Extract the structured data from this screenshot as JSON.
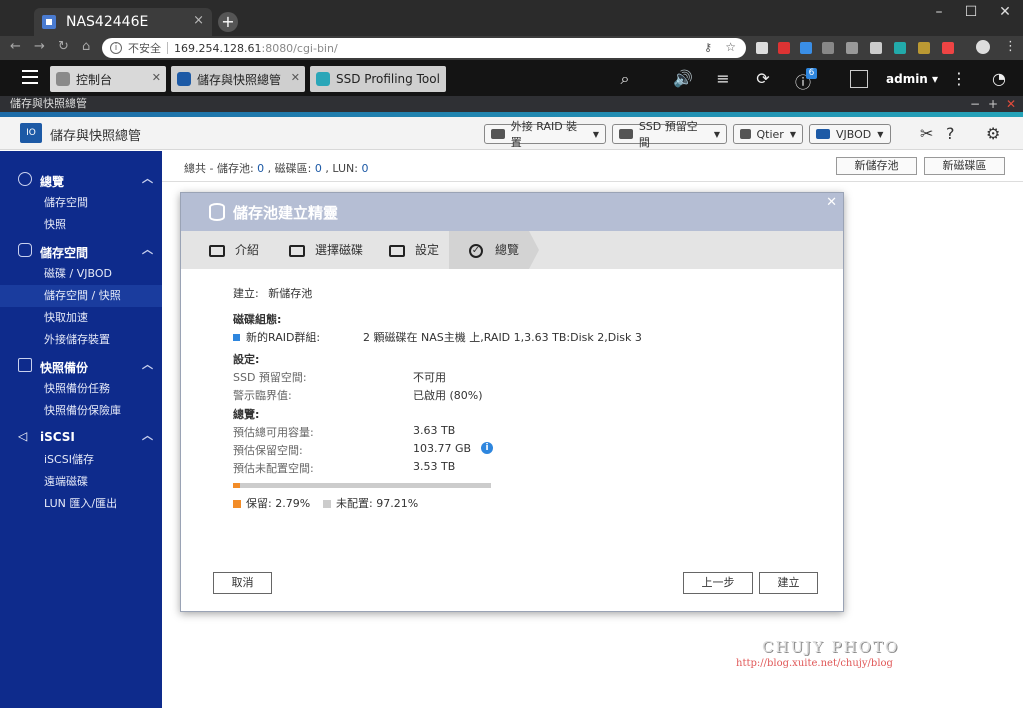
{
  "browser": {
    "tab_title": "NAS42446E",
    "tab_close": "×",
    "new_tab": "+",
    "security_label": "不安全",
    "url_host": "169.254.128.61",
    "url_rest": ":8080/cgi-bin/"
  },
  "qts": {
    "open_tabs": [
      {
        "label": "控制台"
      },
      {
        "label": "儲存與快照總管"
      },
      {
        "label": "SSD Profiling Tool"
      }
    ],
    "notification_count": "6",
    "user": "admin"
  },
  "app": {
    "window_title": "儲存與快照總管",
    "header_title": "儲存與快照總管",
    "toolbar": {
      "external_raid": "外接 RAID 裝置",
      "ssd_overprov": "SSD 預留空間",
      "qtier": "Qtier",
      "vjbod": "VJBOD"
    }
  },
  "sidebar": {
    "sections": [
      {
        "label": "總覽",
        "items": [
          "儲存空間",
          "快照"
        ]
      },
      {
        "label": "儲存空間",
        "items": [
          "磁碟 / VJBOD",
          "儲存空間 / 快照",
          "快取加速",
          "外接儲存裝置"
        ]
      },
      {
        "label": "快照備份",
        "items": [
          "快照備份任務",
          "快照備份保險庫"
        ]
      },
      {
        "label": "iSCSI",
        "items": [
          "iSCSI儲存",
          "遠端磁碟",
          "LUN 匯入/匯出"
        ]
      }
    ]
  },
  "main": {
    "summary_prefix": "總共 - 儲存池:",
    "pool_count": "0",
    "disk_label": ", 磁碟區:",
    "volume_count": "0",
    "lun_label": ", LUN:",
    "lun_count": "0",
    "new_pool_button": "新儲存池",
    "new_volume_button": "新磁碟區"
  },
  "wizard": {
    "title": "儲存池建立精靈",
    "steps": [
      "介紹",
      "選擇磁碟",
      "設定",
      "總覽"
    ],
    "create_label": "建立:",
    "create_value": "新儲存池",
    "disk_group_heading": "磁碟組態:",
    "raid_group_label": "新的RAID群組:",
    "raid_group_value": "2 顆磁碟在 NAS主機 上,RAID 1,3.63 TB:Disk 2,Disk 3",
    "settings_heading": "設定:",
    "ssd_label": "SSD 預留空間:",
    "ssd_value": "不可用",
    "alert_label": "警示臨界值:",
    "alert_value": "已啟用 (80%)",
    "overview_heading": "總覽:",
    "capacity_label": "預估總可用容量:",
    "capacity_value": "3.63 TB",
    "reserved_label": "預估保留空間:",
    "reserved_value": "103.77 GB",
    "unalloc_label": "預估未配置空間:",
    "unalloc_value": "3.53 TB",
    "reserved_fraction": 0.0279,
    "legend_reserved": "保留: 2.79%",
    "legend_unalloc": "未配置: 97.21%",
    "cancel_button": "取消",
    "back_button": "上一步",
    "create_button": "建立"
  },
  "watermark": {
    "line1": "CHUJY PHOTO",
    "line2": "http://blog.xuite.net/chujy/blog"
  },
  "colors": {
    "sidebar": "#0e2b8c",
    "accent": "#2e86de",
    "reserved": "#f28c28",
    "unallocated": "#cccccc"
  }
}
